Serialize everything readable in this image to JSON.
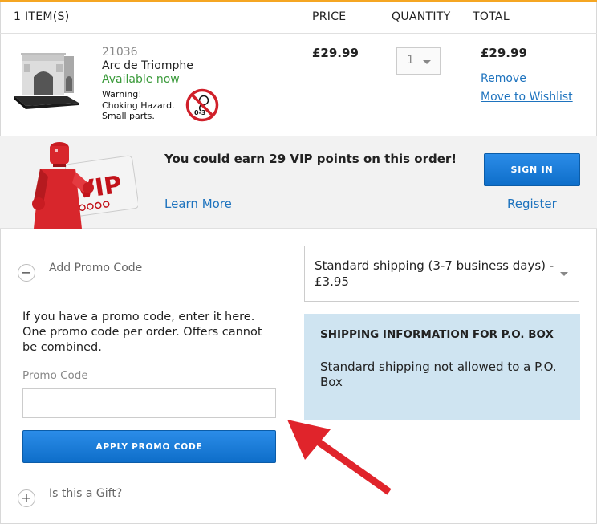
{
  "header": {
    "items_label": "1 ITEM(S)",
    "price_label": "PRICE",
    "quantity_label": "QUANTITY",
    "total_label": "TOTAL"
  },
  "product": {
    "sku": "21036",
    "name": "Arc de Triomphe",
    "availability": "Available now",
    "warning_lines": [
      "Warning!",
      "Choking Hazard.",
      "Small parts."
    ],
    "age_badge": "0-3",
    "price": "£29.99",
    "quantity": "1",
    "total": "£29.99",
    "remove_label": "Remove",
    "wishlist_label": "Move to Wishlist"
  },
  "vip": {
    "message": "You could earn 29 VIP points on this order!",
    "learn_more": "Learn More",
    "sign_in": "SIGN IN",
    "register": "Register",
    "card_text": "VIP"
  },
  "promo": {
    "title": "Add Promo Code",
    "help_text": "If you have a promo code, enter it here. One promo code per order. Offers cannot be combined.",
    "label": "Promo Code",
    "input_value": "",
    "apply_label": "APPLY PROMO CODE",
    "collapse_symbol": "−"
  },
  "gift": {
    "title": "Is this a Gift?",
    "expand_symbol": "+"
  },
  "shipping": {
    "selected": "Standard shipping (3-7 business days) - £3.95",
    "info_title": "SHIPPING INFORMATION FOR P.O. BOX",
    "info_text": "Standard shipping not allowed to a P.O. Box"
  },
  "colors": {
    "accent_blue": "#1e73be",
    "button_blue": "#0e6ec9",
    "available_green": "#3a9a3a",
    "info_box_bg": "#cfe4f1",
    "arrow_red": "#e0242b",
    "top_border": "#f5a623"
  }
}
